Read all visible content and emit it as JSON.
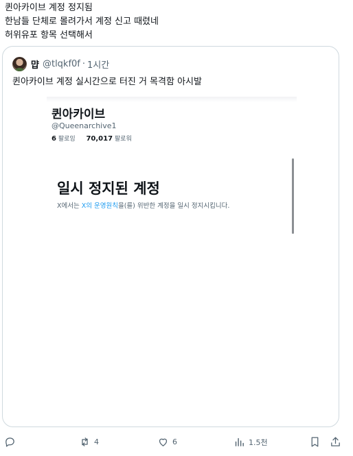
{
  "post": {
    "lines": [
      "퀸아카이브 계정 정지됨",
      "한남들 단체로 몰려가서 계정 신고 때렸네",
      "허위유포 항목 선택해서"
    ]
  },
  "quote": {
    "name": "먑",
    "handle": "@tlqkf0f",
    "dot": "·",
    "time": "1시간",
    "text": "퀸아카이브 계정 실시간으로 터진 거 목격함 아시발"
  },
  "embedded": {
    "name": "퀸아카이브",
    "handle": "@Queenarchive1",
    "following_count": "6",
    "following_label": "팔로잉",
    "followers_count": "70,017",
    "followers_label": "팔로워",
    "suspend_title": "일시 정지된 계정",
    "suspend_prefix": "X에서는 ",
    "suspend_link": "X의 운영원칙",
    "suspend_suffix": "을(를) 위반한 계정을 일시 정지시킵니다."
  },
  "actions": {
    "reply_icon": "reply-icon",
    "retweet_icon": "retweet-icon",
    "retweet_count": "4",
    "like_icon": "heart-icon",
    "like_count": "6",
    "views_icon": "views-icon",
    "views_count": "1.5천",
    "bookmark_icon": "bookmark-icon",
    "share_icon": "share-icon"
  },
  "colors": {
    "text": "#0f1419",
    "muted": "#536471",
    "link": "#1d9bf0",
    "border": "#cfd9de"
  }
}
